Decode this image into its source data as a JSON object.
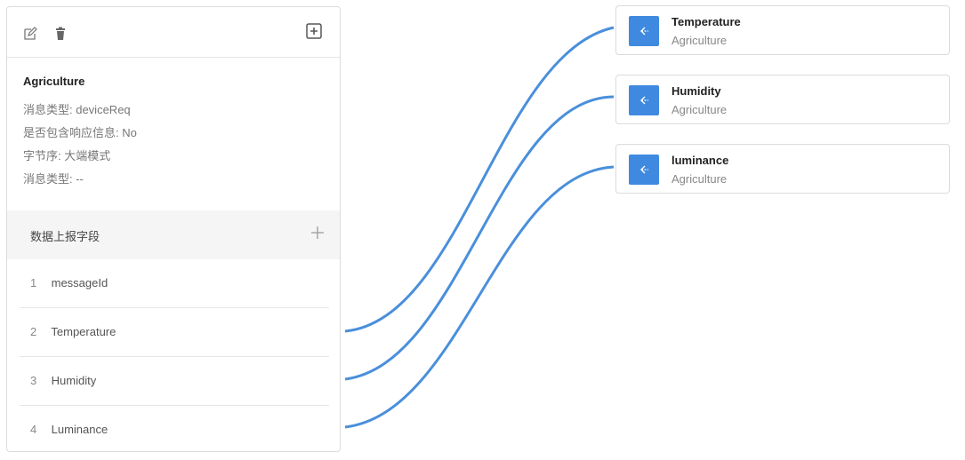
{
  "source_card": {
    "title": "Agriculture",
    "info": [
      "消息类型: deviceReq",
      "是否包含响应信息: No",
      "字节序: 大端模式",
      "消息类型: --"
    ],
    "section_title": "数据上报字段",
    "fields": [
      {
        "num": "1",
        "name": "messageId"
      },
      {
        "num": "2",
        "name": "Temperature"
      },
      {
        "num": "3",
        "name": "Humidity"
      },
      {
        "num": "4",
        "name": "Luminance"
      }
    ]
  },
  "targets": [
    {
      "title": "Temperature",
      "subtitle": "Agriculture"
    },
    {
      "title": "Humidity",
      "subtitle": "Agriculture"
    },
    {
      "title": "luminance",
      "subtitle": "Agriculture"
    }
  ],
  "colors": {
    "accent": "#3f8ae0",
    "connector": "#4a8fdb"
  },
  "icons": {
    "toolbar": [
      "edit-icon",
      "delete-icon",
      "add-box-icon"
    ],
    "section": "plus-icon",
    "target": "input-arrow-icon"
  }
}
